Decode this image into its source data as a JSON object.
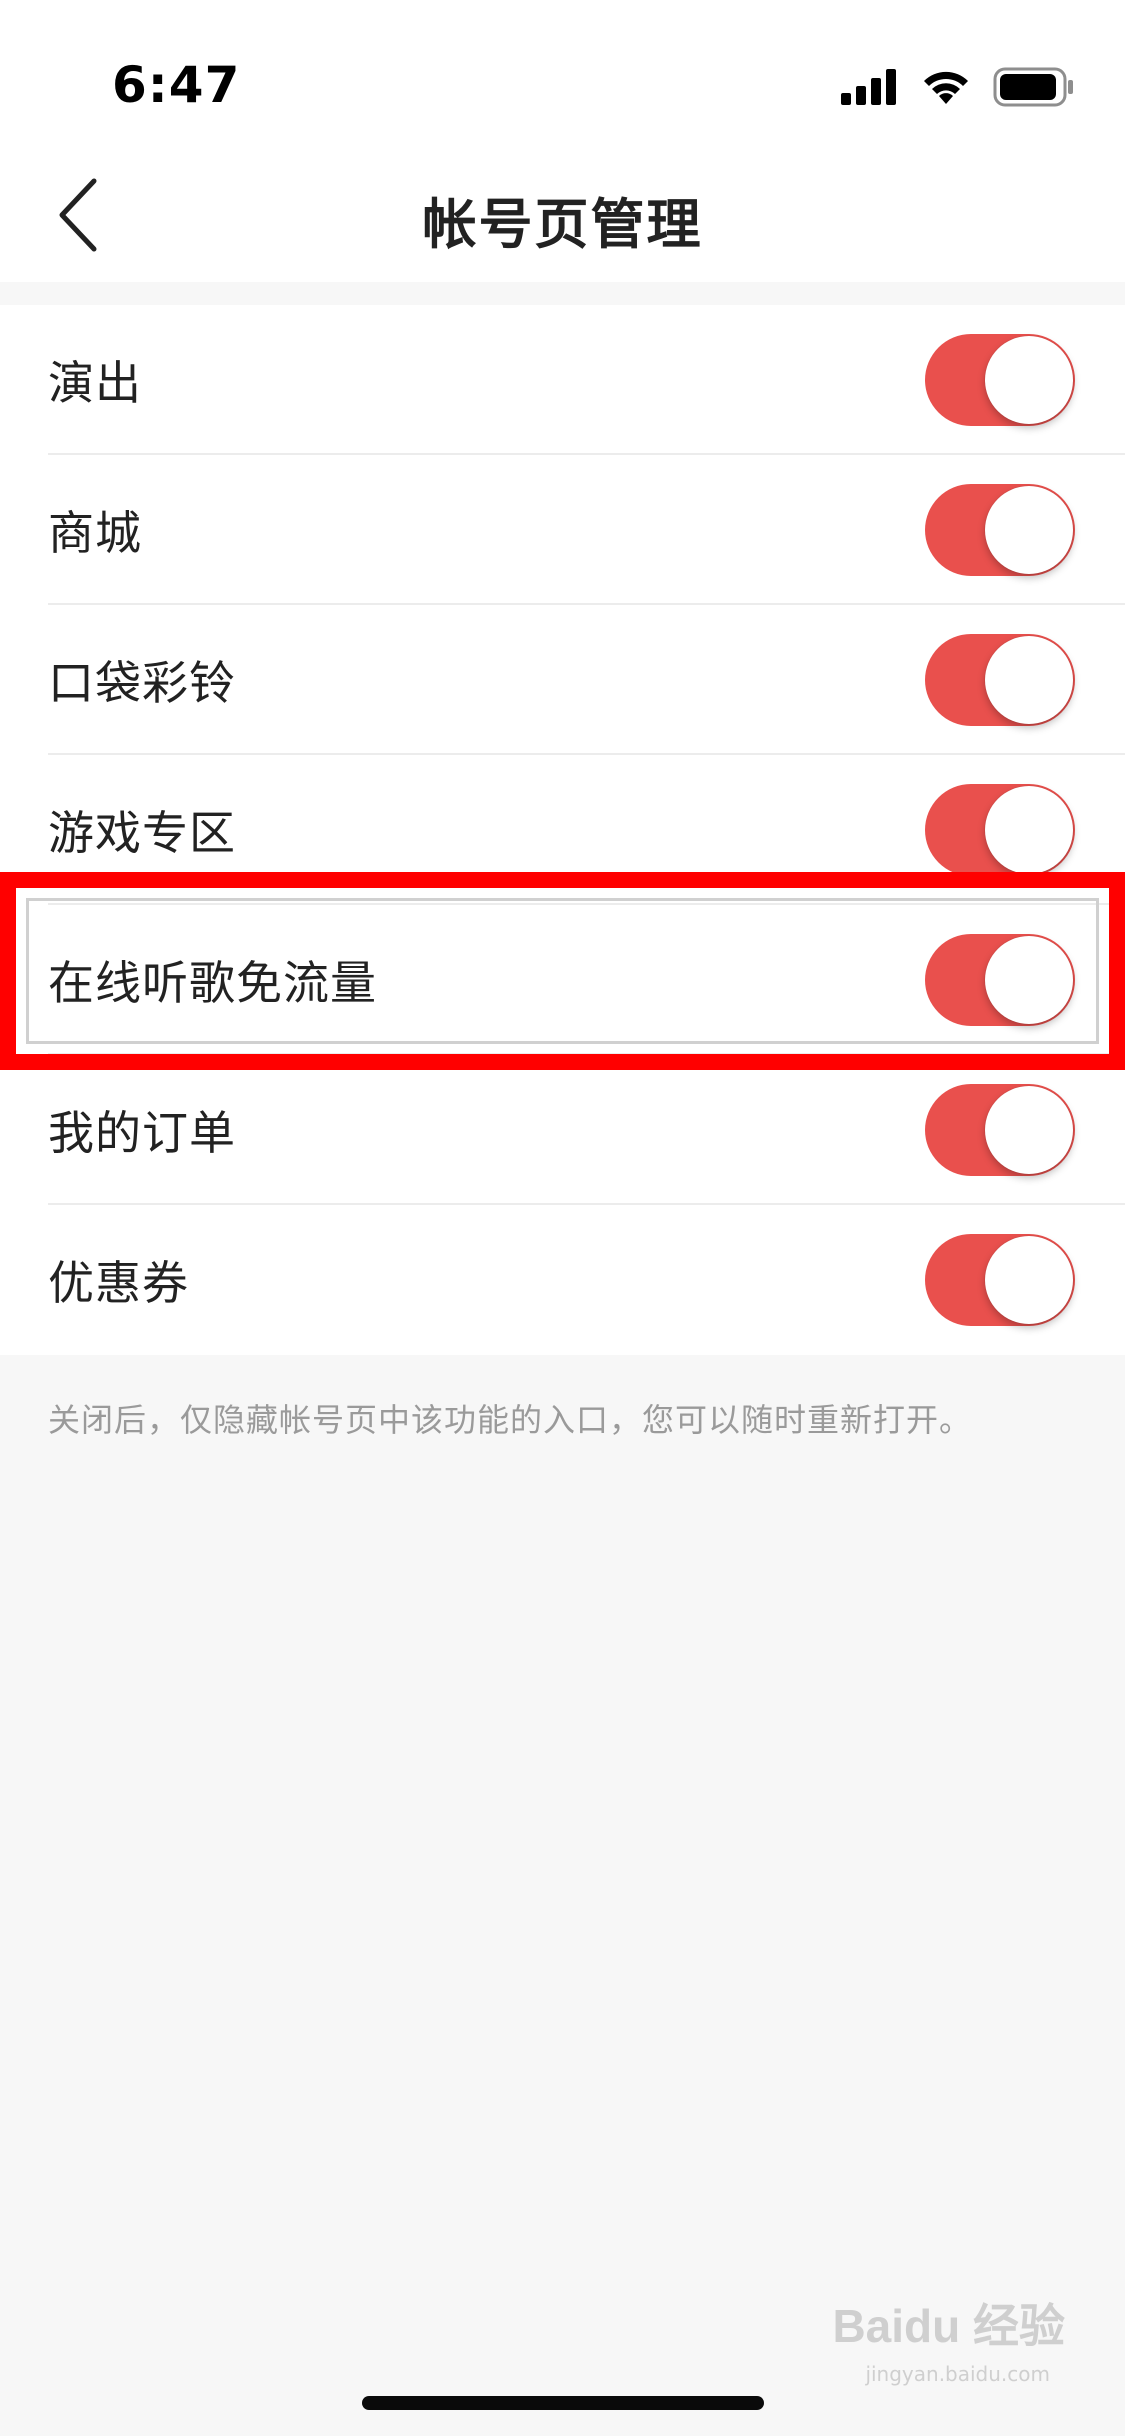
{
  "status_bar": {
    "time": "6:47",
    "icons": [
      "signal-icon",
      "wifi-icon",
      "battery-icon"
    ]
  },
  "nav": {
    "title": "帐号页管理",
    "back_icon": "chevron-left-icon"
  },
  "settings": [
    {
      "label": "演出",
      "enabled": true
    },
    {
      "label": "商城",
      "enabled": true
    },
    {
      "label": "口袋彩铃",
      "enabled": true
    },
    {
      "label": "游戏专区",
      "enabled": true
    },
    {
      "label": "在线听歌免流量",
      "enabled": true
    },
    {
      "label": "我的订单",
      "enabled": true
    },
    {
      "label": "优惠券",
      "enabled": true
    }
  ],
  "footnote": "关闭后，仅隐藏帐号页中该功能的入口，您可以随时重新打开。",
  "watermark": {
    "text": "Baidu 经验",
    "sub": "jingyan.baidu.com"
  },
  "colors": {
    "toggle_on": "#e9504d",
    "highlight": "#ff0000",
    "background": "#f7f7f7"
  }
}
